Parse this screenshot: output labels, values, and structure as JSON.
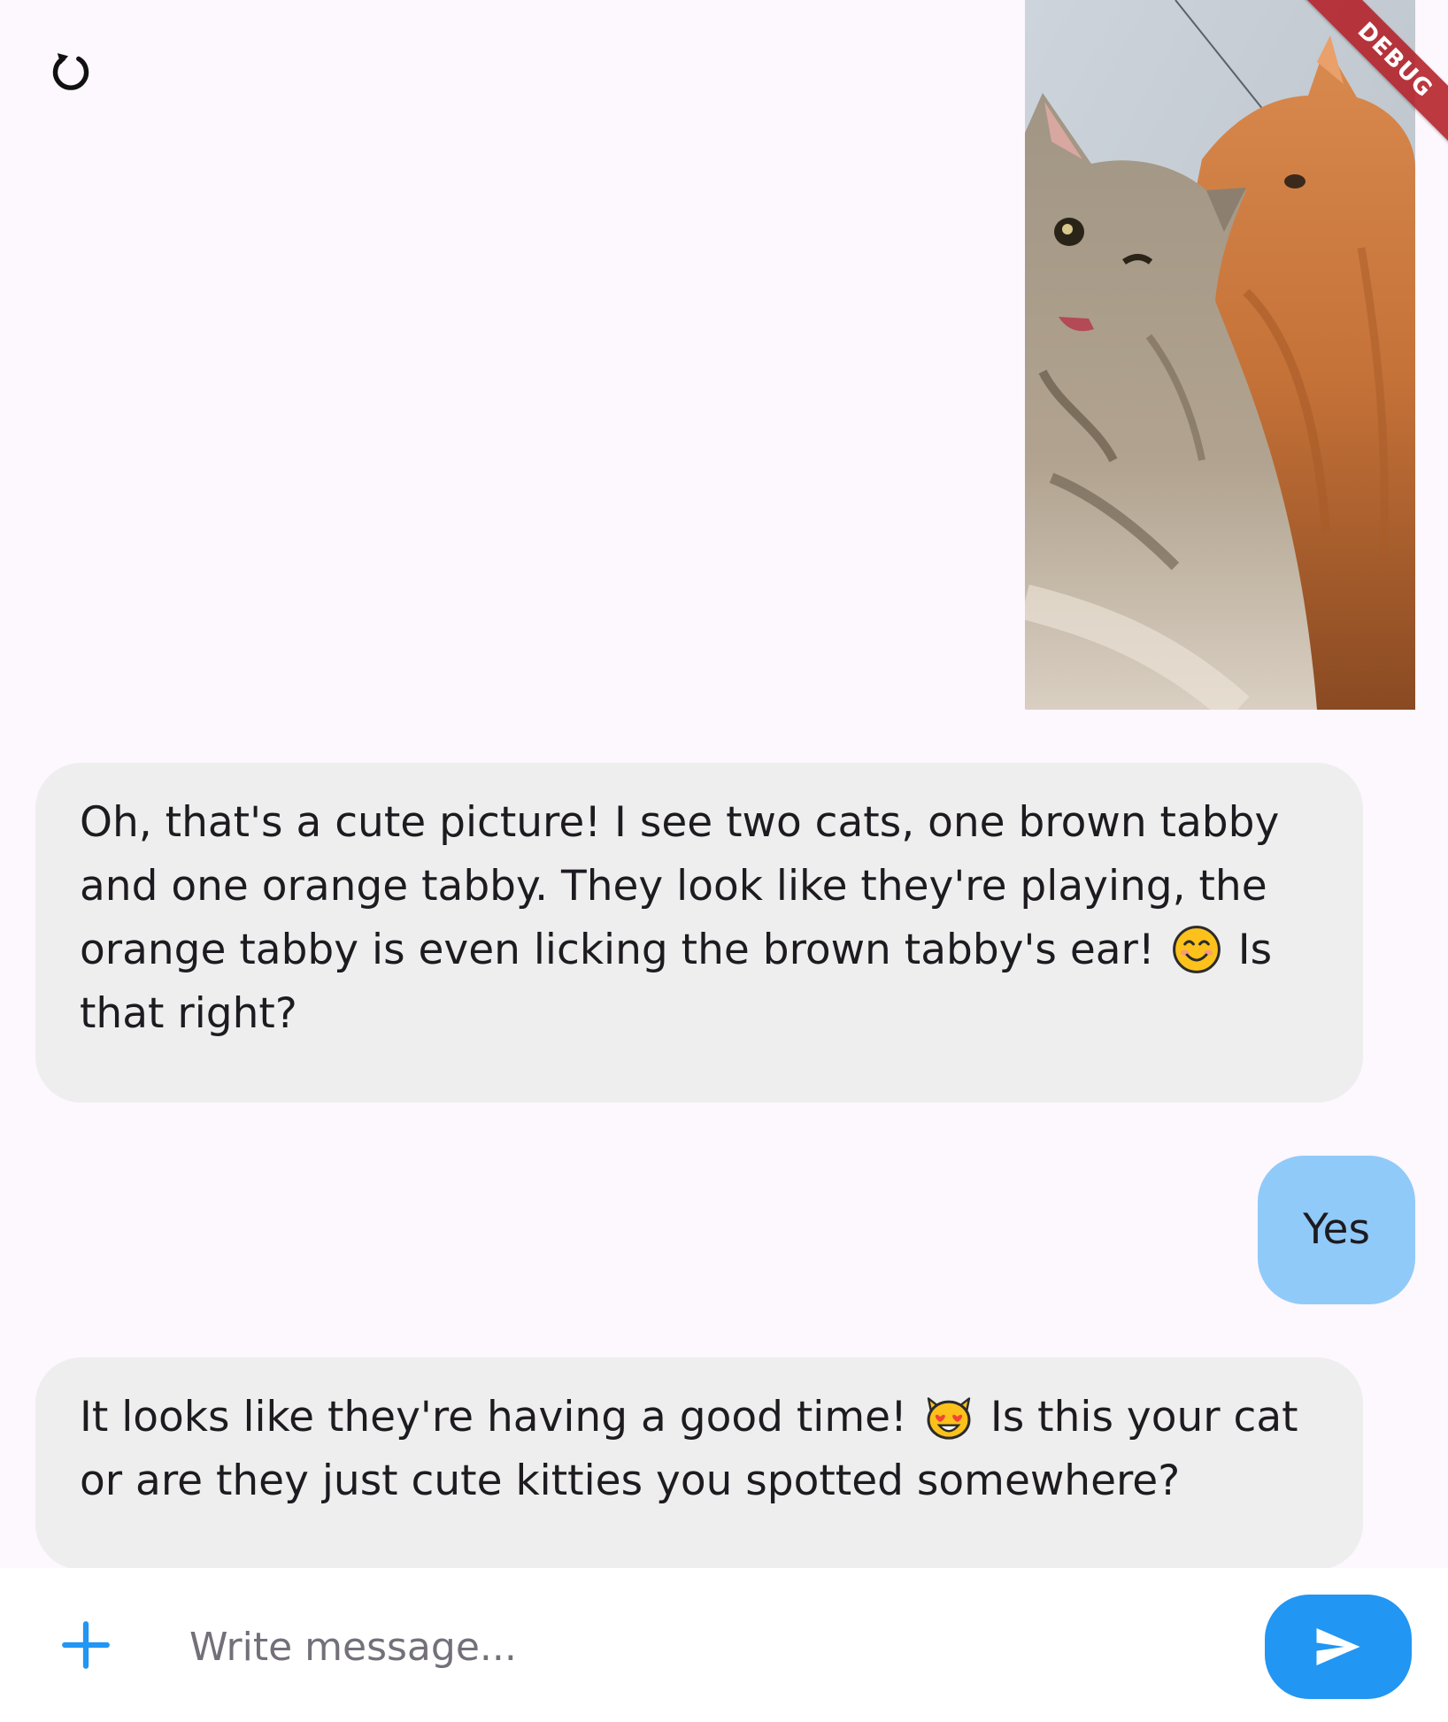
{
  "toolbar": {
    "reset_icon": "reset-icon"
  },
  "debug_banner": {
    "label": "DEBUG"
  },
  "messages": [
    {
      "role": "user",
      "type": "image",
      "alt": "cat-photo"
    },
    {
      "role": "assistant",
      "type": "text",
      "text_before_emoji": "Oh, that's a cute picture!  I see two cats, one brown tabby and one orange tabby.  They look like they're playing,  the orange tabby is even licking the brown tabby's ear!",
      "emoji": "smiling-face-icon",
      "text_after_emoji": "Is that right?"
    },
    {
      "role": "user",
      "type": "text",
      "text": "Yes"
    },
    {
      "role": "assistant",
      "type": "text",
      "text_before_emoji": "It looks like they're having a good time!",
      "emoji": "heart-eyes-cat-icon",
      "text_after_emoji": "Is this your cat or are they just cute kitties you spotted somewhere?"
    }
  ],
  "composer": {
    "placeholder": "Write message...",
    "value": "",
    "attach_icon": "plus-icon",
    "send_icon": "send-icon"
  },
  "colors": {
    "background": "#fdf7fe",
    "assistant_bubble": "#eeeeee",
    "user_bubble": "#90caf9",
    "send_button": "#2196f3",
    "attach_icon": "#2196f3",
    "debug_ribbon": "#b4242a"
  }
}
